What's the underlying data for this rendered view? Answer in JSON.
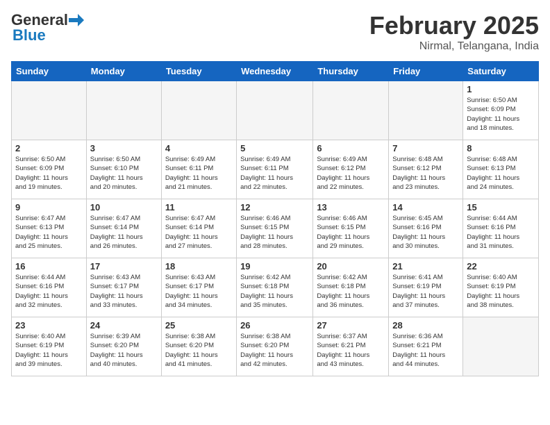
{
  "header": {
    "logo_general": "General",
    "logo_blue": "Blue",
    "title": "February 2025",
    "subtitle": "Nirmal, Telangana, India"
  },
  "days_of_week": [
    "Sunday",
    "Monday",
    "Tuesday",
    "Wednesday",
    "Thursday",
    "Friday",
    "Saturday"
  ],
  "weeks": [
    [
      {
        "day": "",
        "info": ""
      },
      {
        "day": "",
        "info": ""
      },
      {
        "day": "",
        "info": ""
      },
      {
        "day": "",
        "info": ""
      },
      {
        "day": "",
        "info": ""
      },
      {
        "day": "",
        "info": ""
      },
      {
        "day": "1",
        "info": "Sunrise: 6:50 AM\nSunset: 6:09 PM\nDaylight: 11 hours\nand 18 minutes."
      }
    ],
    [
      {
        "day": "2",
        "info": "Sunrise: 6:50 AM\nSunset: 6:09 PM\nDaylight: 11 hours\nand 19 minutes."
      },
      {
        "day": "3",
        "info": "Sunrise: 6:50 AM\nSunset: 6:10 PM\nDaylight: 11 hours\nand 20 minutes."
      },
      {
        "day": "4",
        "info": "Sunrise: 6:49 AM\nSunset: 6:11 PM\nDaylight: 11 hours\nand 21 minutes."
      },
      {
        "day": "5",
        "info": "Sunrise: 6:49 AM\nSunset: 6:11 PM\nDaylight: 11 hours\nand 22 minutes."
      },
      {
        "day": "6",
        "info": "Sunrise: 6:49 AM\nSunset: 6:12 PM\nDaylight: 11 hours\nand 22 minutes."
      },
      {
        "day": "7",
        "info": "Sunrise: 6:48 AM\nSunset: 6:12 PM\nDaylight: 11 hours\nand 23 minutes."
      },
      {
        "day": "8",
        "info": "Sunrise: 6:48 AM\nSunset: 6:13 PM\nDaylight: 11 hours\nand 24 minutes."
      }
    ],
    [
      {
        "day": "9",
        "info": "Sunrise: 6:47 AM\nSunset: 6:13 PM\nDaylight: 11 hours\nand 25 minutes."
      },
      {
        "day": "10",
        "info": "Sunrise: 6:47 AM\nSunset: 6:14 PM\nDaylight: 11 hours\nand 26 minutes."
      },
      {
        "day": "11",
        "info": "Sunrise: 6:47 AM\nSunset: 6:14 PM\nDaylight: 11 hours\nand 27 minutes."
      },
      {
        "day": "12",
        "info": "Sunrise: 6:46 AM\nSunset: 6:15 PM\nDaylight: 11 hours\nand 28 minutes."
      },
      {
        "day": "13",
        "info": "Sunrise: 6:46 AM\nSunset: 6:15 PM\nDaylight: 11 hours\nand 29 minutes."
      },
      {
        "day": "14",
        "info": "Sunrise: 6:45 AM\nSunset: 6:16 PM\nDaylight: 11 hours\nand 30 minutes."
      },
      {
        "day": "15",
        "info": "Sunrise: 6:44 AM\nSunset: 6:16 PM\nDaylight: 11 hours\nand 31 minutes."
      }
    ],
    [
      {
        "day": "16",
        "info": "Sunrise: 6:44 AM\nSunset: 6:16 PM\nDaylight: 11 hours\nand 32 minutes."
      },
      {
        "day": "17",
        "info": "Sunrise: 6:43 AM\nSunset: 6:17 PM\nDaylight: 11 hours\nand 33 minutes."
      },
      {
        "day": "18",
        "info": "Sunrise: 6:43 AM\nSunset: 6:17 PM\nDaylight: 11 hours\nand 34 minutes."
      },
      {
        "day": "19",
        "info": "Sunrise: 6:42 AM\nSunset: 6:18 PM\nDaylight: 11 hours\nand 35 minutes."
      },
      {
        "day": "20",
        "info": "Sunrise: 6:42 AM\nSunset: 6:18 PM\nDaylight: 11 hours\nand 36 minutes."
      },
      {
        "day": "21",
        "info": "Sunrise: 6:41 AM\nSunset: 6:19 PM\nDaylight: 11 hours\nand 37 minutes."
      },
      {
        "day": "22",
        "info": "Sunrise: 6:40 AM\nSunset: 6:19 PM\nDaylight: 11 hours\nand 38 minutes."
      }
    ],
    [
      {
        "day": "23",
        "info": "Sunrise: 6:40 AM\nSunset: 6:19 PM\nDaylight: 11 hours\nand 39 minutes."
      },
      {
        "day": "24",
        "info": "Sunrise: 6:39 AM\nSunset: 6:20 PM\nDaylight: 11 hours\nand 40 minutes."
      },
      {
        "day": "25",
        "info": "Sunrise: 6:38 AM\nSunset: 6:20 PM\nDaylight: 11 hours\nand 41 minutes."
      },
      {
        "day": "26",
        "info": "Sunrise: 6:38 AM\nSunset: 6:20 PM\nDaylight: 11 hours\nand 42 minutes."
      },
      {
        "day": "27",
        "info": "Sunrise: 6:37 AM\nSunset: 6:21 PM\nDaylight: 11 hours\nand 43 minutes."
      },
      {
        "day": "28",
        "info": "Sunrise: 6:36 AM\nSunset: 6:21 PM\nDaylight: 11 hours\nand 44 minutes."
      },
      {
        "day": "",
        "info": ""
      }
    ]
  ]
}
